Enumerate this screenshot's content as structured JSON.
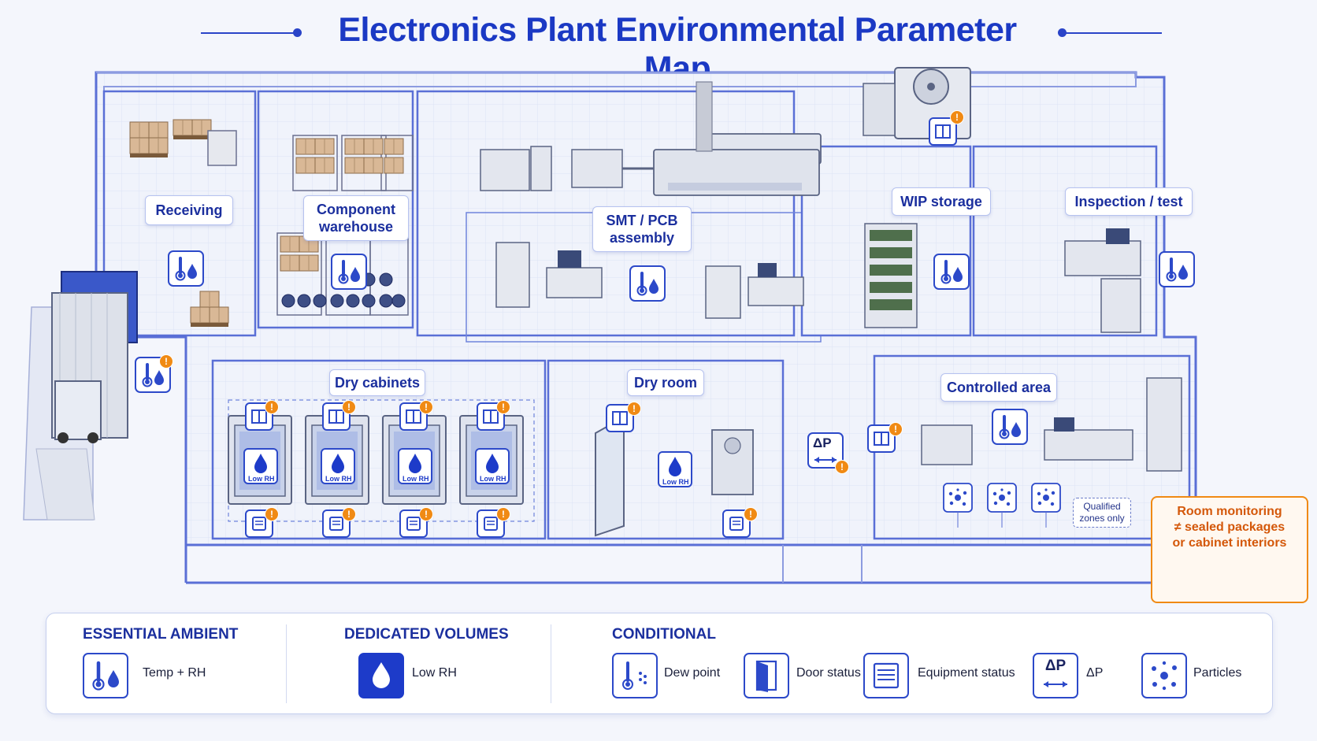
{
  "title": "Electronics Plant Environmental Parameter Map",
  "zones": {
    "receiving": "Receiving",
    "component_warehouse_line1": "Component",
    "component_warehouse_line2": "warehouse",
    "smt_line1": "SMT / PCB",
    "smt_line2": "assembly",
    "wip_storage": "WIP storage",
    "inspection_test": "Inspection / test",
    "dry_cabinets": "Dry cabinets",
    "dry_room": "Dry room",
    "controlled_area": "Controlled area"
  },
  "delta_p_label": "ΔP",
  "low_rh_tag": "Low RH",
  "qualified_zones": {
    "line1": "Qualified",
    "line2": "zones only"
  },
  "callout": {
    "line1": "Room monitoring",
    "line2": "≠ sealed packages",
    "line3": "or cabinet interiors"
  },
  "legend": {
    "essential": {
      "heading": "ESSENTIAL AMBIENT",
      "item": "Temp + RH",
      "icon": "thermometer-droplet-icon"
    },
    "dedicated": {
      "heading": "DEDICATED VOLUMES",
      "item": "Low RH",
      "icon": "droplet-icon"
    },
    "conditional": {
      "heading": "CONDITIONAL",
      "items": [
        {
          "label": "Dew point",
          "icon": "dew-point-icon"
        },
        {
          "label": "Door status",
          "icon": "door-icon"
        },
        {
          "label": "Equipment status",
          "icon": "equipment-icon"
        },
        {
          "label": "ΔP",
          "icon": "delta-p-icon"
        },
        {
          "label": "Particles",
          "icon": "particles-icon"
        }
      ]
    }
  },
  "colors": {
    "primary_blue": "#1b39c4",
    "alert_orange": "#f08a14",
    "wall_blue": "#5a6fd6",
    "floor": "#eef1fa"
  }
}
